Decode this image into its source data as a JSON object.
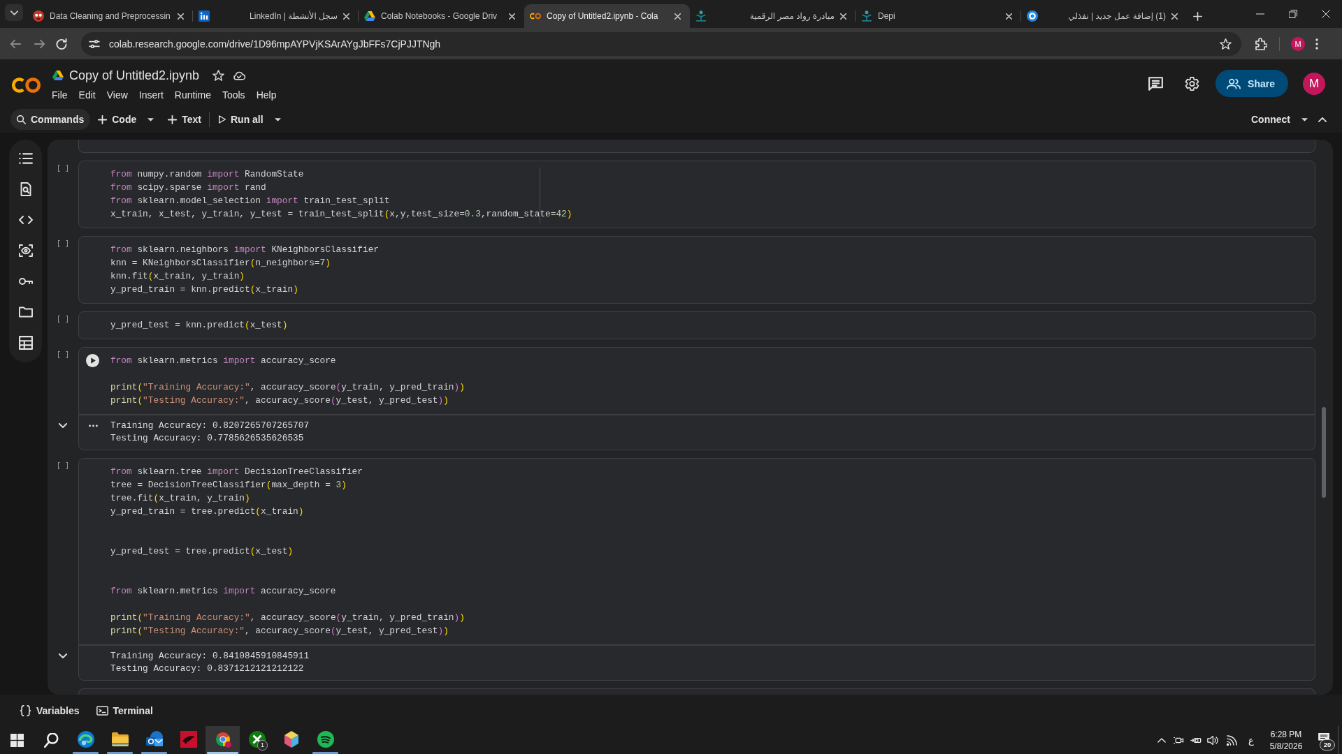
{
  "browser": {
    "tabs": [
      {
        "title": "Data Cleaning and Preprocessin",
        "selected": false
      },
      {
        "title": "سجل الأنشطة | LinkedIn",
        "selected": false
      },
      {
        "title": "Colab Notebooks - Google Driv",
        "selected": false
      },
      {
        "title": "Copy of Untitled2.ipynb - Cola",
        "selected": true
      },
      {
        "title": "مبادرة رواد مصر الرقمية",
        "selected": false
      },
      {
        "title": "Depi",
        "selected": false
      },
      {
        "title": "(1) إضافة عمل جديد | نفذلي",
        "selected": false
      }
    ],
    "address": "colab.research.google.com/drive/1D96mpAYPVjKSArAYgJbFFs7CjPJJTNgh",
    "profile": "M"
  },
  "notebook": {
    "title": "Copy of Untitled2.ipynb",
    "menu": [
      "File",
      "Edit",
      "View",
      "Insert",
      "Runtime",
      "Tools",
      "Help"
    ],
    "toolbar": {
      "commands": "Commands",
      "code": "Code",
      "text": "Text",
      "run_all": "Run all",
      "connect": "Connect"
    },
    "share": "Share",
    "avatar": "M",
    "cells": [
      {
        "kind": "clipped"
      },
      {
        "kind": "code",
        "prompt": "[ ]",
        "hovered": false,
        "ruler": true,
        "lines": [
          {
            "kind": "code",
            "tokens": [
              {
                "kind": "keyword",
                "text": "from"
              },
              {
                "kind": "plain",
                "text": " numpy.random "
              },
              {
                "kind": "keyword",
                "text": "import"
              },
              {
                "kind": "plain",
                "text": " RandomState"
              }
            ]
          },
          {
            "kind": "code",
            "tokens": [
              {
                "kind": "keyword",
                "text": "from"
              },
              {
                "kind": "plain",
                "text": " scipy.sparse "
              },
              {
                "kind": "keyword",
                "text": "import"
              },
              {
                "kind": "plain",
                "text": " rand"
              }
            ]
          },
          {
            "kind": "code",
            "tokens": [
              {
                "kind": "keyword",
                "text": "from"
              },
              {
                "kind": "plain",
                "text": " sklearn.model_selection "
              },
              {
                "kind": "keyword",
                "text": "import"
              },
              {
                "kind": "plain",
                "text": " train_test_split"
              }
            ]
          },
          {
            "kind": "code",
            "tokens": [
              {
                "kind": "plain",
                "text": "x_train, x_test, y_train, y_test = train_test_split"
              },
              {
                "kind": "paren1",
                "text": "("
              },
              {
                "kind": "plain",
                "text": "x,y,test_size="
              },
              {
                "kind": "number",
                "text": "0.3"
              },
              {
                "kind": "plain",
                "text": ",random_state="
              },
              {
                "kind": "number",
                "text": "42"
              },
              {
                "kind": "paren1",
                "text": ")"
              }
            ]
          }
        ]
      },
      {
        "kind": "code",
        "prompt": "[ ]",
        "hovered": false,
        "ruler": false,
        "lines": [
          {
            "kind": "code",
            "tokens": [
              {
                "kind": "keyword",
                "text": "from"
              },
              {
                "kind": "plain",
                "text": " sklearn.neighbors "
              },
              {
                "kind": "keyword",
                "text": "import"
              },
              {
                "kind": "plain",
                "text": " KNeighborsClassifier"
              }
            ]
          },
          {
            "kind": "code",
            "tokens": [
              {
                "kind": "plain",
                "text": "knn = KNeighborsClassifier"
              },
              {
                "kind": "paren1",
                "text": "("
              },
              {
                "kind": "plain",
                "text": "n_neighbors="
              },
              {
                "kind": "number",
                "text": "7"
              },
              {
                "kind": "paren1",
                "text": ")"
              }
            ]
          },
          {
            "kind": "code",
            "tokens": [
              {
                "kind": "plain",
                "text": "knn.fit"
              },
              {
                "kind": "paren1",
                "text": "("
              },
              {
                "kind": "plain",
                "text": "x_train, y_train"
              },
              {
                "kind": "paren1",
                "text": ")"
              }
            ]
          },
          {
            "kind": "code",
            "tokens": [
              {
                "kind": "plain",
                "text": "y_pred_train = knn.predict"
              },
              {
                "kind": "paren1",
                "text": "("
              },
              {
                "kind": "plain",
                "text": "x_train"
              },
              {
                "kind": "paren1",
                "text": ")"
              }
            ]
          }
        ]
      },
      {
        "kind": "code",
        "prompt": "[ ]",
        "hovered": false,
        "ruler": false,
        "lines": [
          {
            "kind": "code",
            "tokens": [
              {
                "kind": "plain",
                "text": "y_pred_test = knn.predict"
              },
              {
                "kind": "paren1",
                "text": "("
              },
              {
                "kind": "plain",
                "text": "x_test"
              },
              {
                "kind": "paren1",
                "text": ")"
              }
            ]
          }
        ]
      },
      {
        "kind": "code",
        "prompt": "[ ]",
        "hovered": true,
        "ruler": false,
        "lines": [
          {
            "kind": "code",
            "tokens": [
              {
                "kind": "keyword",
                "text": "from"
              },
              {
                "kind": "plain",
                "text": " sklearn.metrics "
              },
              {
                "kind": "keyword",
                "text": "import"
              },
              {
                "kind": "plain",
                "text": " accuracy_score"
              }
            ]
          },
          {
            "kind": "blank"
          },
          {
            "kind": "code",
            "tokens": [
              {
                "kind": "builtin",
                "text": "print"
              },
              {
                "kind": "paren1",
                "text": "("
              },
              {
                "kind": "string",
                "text": "\"Training Accuracy:\""
              },
              {
                "kind": "plain",
                "text": ", accuracy_score"
              },
              {
                "kind": "paren2",
                "text": "("
              },
              {
                "kind": "plain",
                "text": "y_train, y_pred_train"
              },
              {
                "kind": "paren2",
                "text": ")"
              },
              {
                "kind": "paren1",
                "text": ")"
              }
            ]
          },
          {
            "kind": "code",
            "tokens": [
              {
                "kind": "builtin",
                "text": "print"
              },
              {
                "kind": "paren1",
                "text": "("
              },
              {
                "kind": "string",
                "text": "\"Testing Accuracy:\""
              },
              {
                "kind": "plain",
                "text": ", accuracy_score"
              },
              {
                "kind": "paren2",
                "text": "("
              },
              {
                "kind": "plain",
                "text": "y_test, y_pred_test"
              },
              {
                "kind": "paren2",
                "text": ")"
              },
              {
                "kind": "paren1",
                "text": ")"
              }
            ]
          }
        ],
        "output": {
          "expanded": true,
          "lines": [
            "Training Accuracy: 0.8207265707265707",
            "Testing Accuracy: 0.7785626535626535"
          ]
        }
      },
      {
        "kind": "code",
        "prompt": "[ ]",
        "hovered": false,
        "ruler": false,
        "lines": [
          {
            "kind": "code",
            "tokens": [
              {
                "kind": "keyword",
                "text": "from"
              },
              {
                "kind": "plain",
                "text": " sklearn.tree "
              },
              {
                "kind": "keyword",
                "text": "import"
              },
              {
                "kind": "plain",
                "text": " DecisionTreeClassifier"
              }
            ]
          },
          {
            "kind": "code",
            "tokens": [
              {
                "kind": "plain",
                "text": "tree = DecisionTreeClassifier"
              },
              {
                "kind": "paren1",
                "text": "("
              },
              {
                "kind": "plain",
                "text": "max_depth = "
              },
              {
                "kind": "number",
                "text": "3"
              },
              {
                "kind": "paren1",
                "text": ")"
              }
            ]
          },
          {
            "kind": "code",
            "tokens": [
              {
                "kind": "plain",
                "text": "tree.fit"
              },
              {
                "kind": "paren1",
                "text": "("
              },
              {
                "kind": "plain",
                "text": "x_train, y_train"
              },
              {
                "kind": "paren1",
                "text": ")"
              }
            ]
          },
          {
            "kind": "code",
            "tokens": [
              {
                "kind": "plain",
                "text": "y_pred_train = tree.predict"
              },
              {
                "kind": "paren1",
                "text": "("
              },
              {
                "kind": "plain",
                "text": "x_train"
              },
              {
                "kind": "paren1",
                "text": ")"
              }
            ]
          },
          {
            "kind": "blank"
          },
          {
            "kind": "blank"
          },
          {
            "kind": "code",
            "tokens": [
              {
                "kind": "plain",
                "text": "y_pred_test = tree.predict"
              },
              {
                "kind": "paren1",
                "text": "("
              },
              {
                "kind": "plain",
                "text": "x_test"
              },
              {
                "kind": "paren1",
                "text": ")"
              }
            ]
          },
          {
            "kind": "blank"
          },
          {
            "kind": "blank"
          },
          {
            "kind": "code",
            "tokens": [
              {
                "kind": "keyword",
                "text": "from"
              },
              {
                "kind": "plain",
                "text": " sklearn.metrics "
              },
              {
                "kind": "keyword",
                "text": "import"
              },
              {
                "kind": "plain",
                "text": " accuracy_score"
              }
            ]
          },
          {
            "kind": "blank"
          },
          {
            "kind": "code",
            "tokens": [
              {
                "kind": "builtin",
                "text": "print"
              },
              {
                "kind": "paren1",
                "text": "("
              },
              {
                "kind": "string",
                "text": "\"Training Accuracy:\""
              },
              {
                "kind": "plain",
                "text": ", accuracy_score"
              },
              {
                "kind": "paren2",
                "text": "("
              },
              {
                "kind": "plain",
                "text": "y_train, y_pred_train"
              },
              {
                "kind": "paren2",
                "text": ")"
              },
              {
                "kind": "paren1",
                "text": ")"
              }
            ]
          },
          {
            "kind": "code",
            "tokens": [
              {
                "kind": "builtin",
                "text": "print"
              },
              {
                "kind": "paren1",
                "text": "("
              },
              {
                "kind": "string",
                "text": "\"Testing Accuracy:\""
              },
              {
                "kind": "plain",
                "text": ", accuracy_score"
              },
              {
                "kind": "paren2",
                "text": "("
              },
              {
                "kind": "plain",
                "text": "y_test, y_pred_test"
              },
              {
                "kind": "paren2",
                "text": ")"
              },
              {
                "kind": "paren1",
                "text": ")"
              }
            ]
          }
        ],
        "output": {
          "expanded": true,
          "lines": [
            "Training Accuracy: 0.8410845910845911",
            "Testing Accuracy: 0.8371212121212122"
          ]
        }
      },
      {
        "kind": "clipped"
      }
    ]
  },
  "bottom_bar": {
    "items": [
      {
        "kind": "variables",
        "label": "Variables"
      },
      {
        "kind": "terminal",
        "label": "Terminal"
      }
    ]
  },
  "taskbar": {
    "apps": [
      {
        "selected": false,
        "running": true
      },
      {
        "selected": false,
        "running": true
      },
      {
        "selected": false,
        "running": true
      },
      {
        "selected": false,
        "running": false
      },
      {
        "selected": true,
        "running": true
      },
      {
        "selected": false,
        "running": false,
        "badge": "1"
      },
      {
        "selected": false,
        "running": false
      },
      {
        "selected": false,
        "running": true
      }
    ],
    "language": "ع",
    "time": "6:28 PM",
    "date": "5/8/2026",
    "notifications": "20"
  }
}
